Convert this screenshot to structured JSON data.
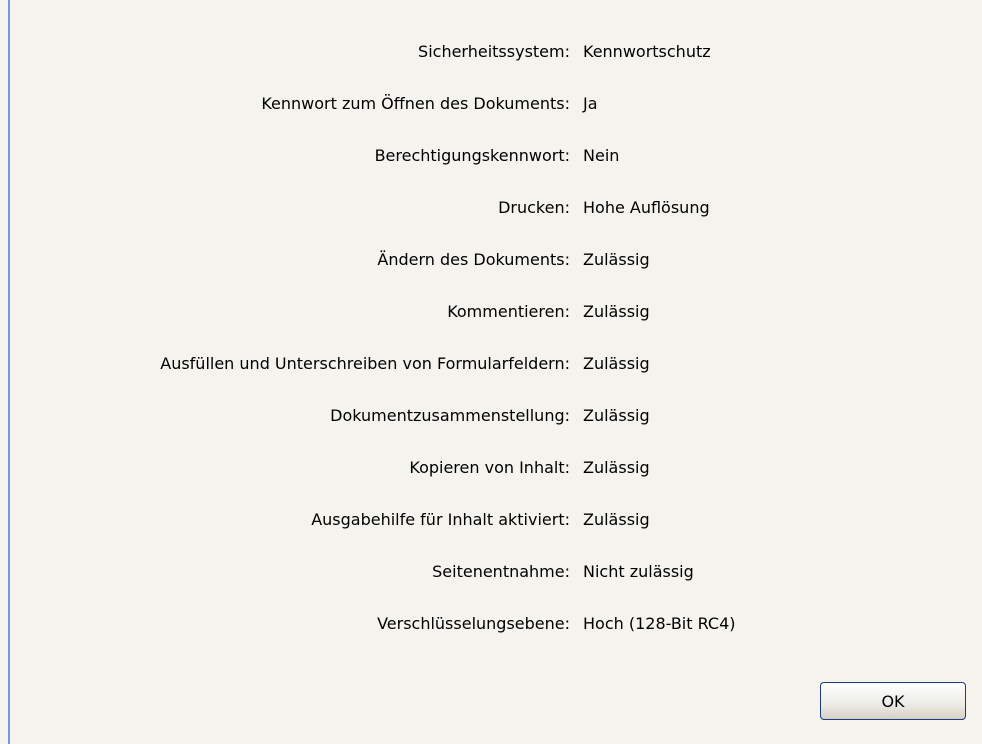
{
  "rows": [
    {
      "label": "Sicherheitssystem:",
      "value": "Kennwortschutz"
    },
    {
      "label": "Kennwort zum Öffnen des Dokuments:",
      "value": "Ja"
    },
    {
      "label": "Berechtigungskennwort:",
      "value": "Nein"
    },
    {
      "label": "Drucken:",
      "value": "Hohe Auflösung"
    },
    {
      "label": "Ändern des Dokuments:",
      "value": "Zulässig"
    },
    {
      "label": "Kommentieren:",
      "value": "Zulässig"
    },
    {
      "label": "Ausfüllen und Unterschreiben von Formularfeldern:",
      "value": "Zulässig"
    },
    {
      "label": "Dokumentzusammenstellung:",
      "value": "Zulässig"
    },
    {
      "label": "Kopieren von Inhalt:",
      "value": "Zulässig"
    },
    {
      "label": "Ausgabehilfe für Inhalt aktiviert:",
      "value": "Zulässig"
    },
    {
      "label": "Seitenentnahme:",
      "value": "Nicht zulässig"
    },
    {
      "label": "Verschlüsselungsebene:",
      "value": "Hoch (128-Bit RC4)"
    }
  ],
  "buttons": {
    "ok_label": "OK"
  },
  "colors": {
    "background": "#f4f3ee",
    "left_border": "#7a96df",
    "button_border": "#1c3d7a"
  }
}
